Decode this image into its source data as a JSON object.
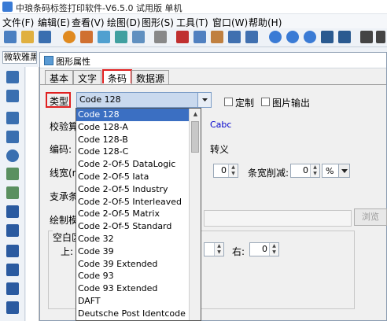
{
  "window": {
    "title": "中琅条码标签打印软件-V6.5.0 试用版 单机"
  },
  "menu": [
    "文件(F)",
    "编辑(E)",
    "查看(V)",
    "绘图(D)",
    "图形(S)",
    "工具(T)",
    "窗口(W)",
    "帮助(H)"
  ],
  "font_box": {
    "value": "微软雅黑"
  },
  "dialog": {
    "title": "图形属性",
    "tabs": [
      "基本",
      "文字",
      "条码",
      "数据源"
    ],
    "type_label": "类型",
    "type_value": "Code 128",
    "custom_label": "定制",
    "image_output_label": "图片输出",
    "checksum_label": "校验算",
    "checksum_value": "Cabc",
    "encoding_label": "编码:",
    "escape_label": "转义",
    "linewidth_label": "线宽(m",
    "linewidth_value": "0",
    "bar_reduce_label": "条宽削减:",
    "bar_reduce_value": "0",
    "bar_reduce_unit": "%",
    "support_label": "支承条",
    "draw_label": "绘制模",
    "browse_label": "浏览",
    "blank_label": "空白区",
    "top_label": "上:",
    "top_value": "",
    "right_label": "右:",
    "right_value": "0"
  },
  "type_options": [
    "Code 128",
    "Code 128-A",
    "Code 128-B",
    "Code 128-C",
    "Code 2-Of-5 DataLogic",
    "Code 2-Of-5 Iata",
    "Code 2-Of-5 Industry",
    "Code 2-Of-5 Interleaved",
    "Code 2-Of-5 Matrix",
    "Code 2-Of-5 Standard",
    "Code 32",
    "Code 39",
    "Code 39 Extended",
    "Code 93",
    "Code 93 Extended",
    "DAFT",
    "Deutsche Post Identcode"
  ],
  "colors": {
    "selected": "#3b6fc2",
    "highlight": "#e02020",
    "checksum": "#0000cc"
  }
}
